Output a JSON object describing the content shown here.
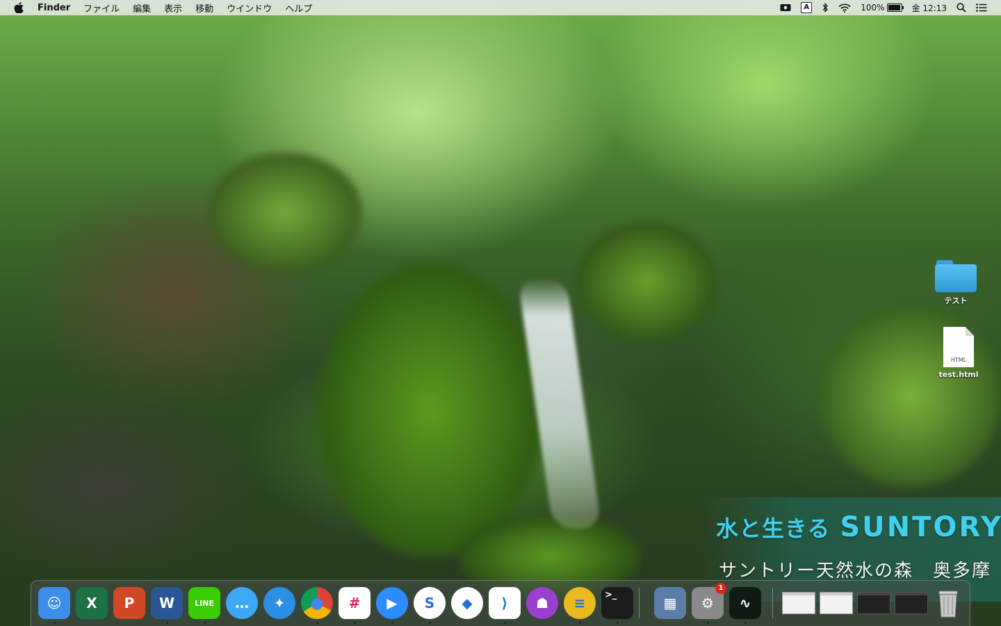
{
  "menubar": {
    "app_name": "Finder",
    "menus": [
      "ファイル",
      "編集",
      "表示",
      "移動",
      "ウインドウ",
      "ヘルプ"
    ],
    "input_source": "A",
    "battery_text": "100%",
    "battery_level": 1.0,
    "clock": "金 12:13"
  },
  "desktop": {
    "icons": [
      {
        "label": "テスト",
        "kind": "folder-icon"
      },
      {
        "label": "test.html",
        "kind": "html-document-icon",
        "ext": "HTML"
      }
    ]
  },
  "wallpaper": {
    "brand_text": "水と生きる",
    "brand_logo": "SUNTORY",
    "caption": "サントリー天然水の森　奥多摩"
  },
  "dock": {
    "apps": [
      {
        "name": "finder",
        "glyph": "☺",
        "bg": "#3b8fe8"
      },
      {
        "name": "excel",
        "glyph": "X",
        "bg": "#1e7145"
      },
      {
        "name": "powerpoint",
        "glyph": "P",
        "bg": "#d24726"
      },
      {
        "name": "word",
        "glyph": "W",
        "bg": "#2b5797"
      },
      {
        "name": "line",
        "glyph": "LINE",
        "bg": "#3acd01"
      },
      {
        "name": "messages",
        "glyph": "…",
        "bg": "#3da9f5"
      },
      {
        "name": "safari",
        "glyph": "✦",
        "bg": "#2c8fe6"
      },
      {
        "name": "chrome",
        "glyph": "●",
        "bg": "#ffffff"
      },
      {
        "name": "slack",
        "glyph": "#",
        "bg": "#ffffff"
      },
      {
        "name": "zoom",
        "glyph": "▶",
        "bg": "#2d8cff"
      },
      {
        "name": "app-s",
        "glyph": "S",
        "bg": "#ffffff"
      },
      {
        "name": "app-diamond",
        "glyph": "◆",
        "bg": "#ffffff"
      },
      {
        "name": "vscode",
        "glyph": "⟩",
        "bg": "#ffffff"
      },
      {
        "name": "github",
        "glyph": "☗",
        "bg": "#9a3fd0"
      },
      {
        "name": "sequel",
        "glyph": "≡",
        "bg": "#e9b91f"
      },
      {
        "name": "terminal",
        "glyph": ">_",
        "bg": "#1b1b1b"
      },
      {
        "name": "preview",
        "glyph": "▦",
        "bg": "#5a7ea8"
      },
      {
        "name": "system-preferences",
        "glyph": "⚙",
        "bg": "#8a8a8a",
        "badge": "1"
      },
      {
        "name": "activity-monitor",
        "glyph": "∿",
        "bg": "#0e1a12"
      }
    ],
    "windows": [
      {
        "name": "window-thumb-1",
        "dark": false
      },
      {
        "name": "window-thumb-2",
        "dark": false
      },
      {
        "name": "window-thumb-3",
        "dark": true
      },
      {
        "name": "window-thumb-4",
        "dark": true
      }
    ],
    "trash": {
      "name": "trash"
    }
  },
  "colors": {
    "menubar_bg": "#e1e6e1",
    "brand_cyan": "#3fd0ef"
  }
}
